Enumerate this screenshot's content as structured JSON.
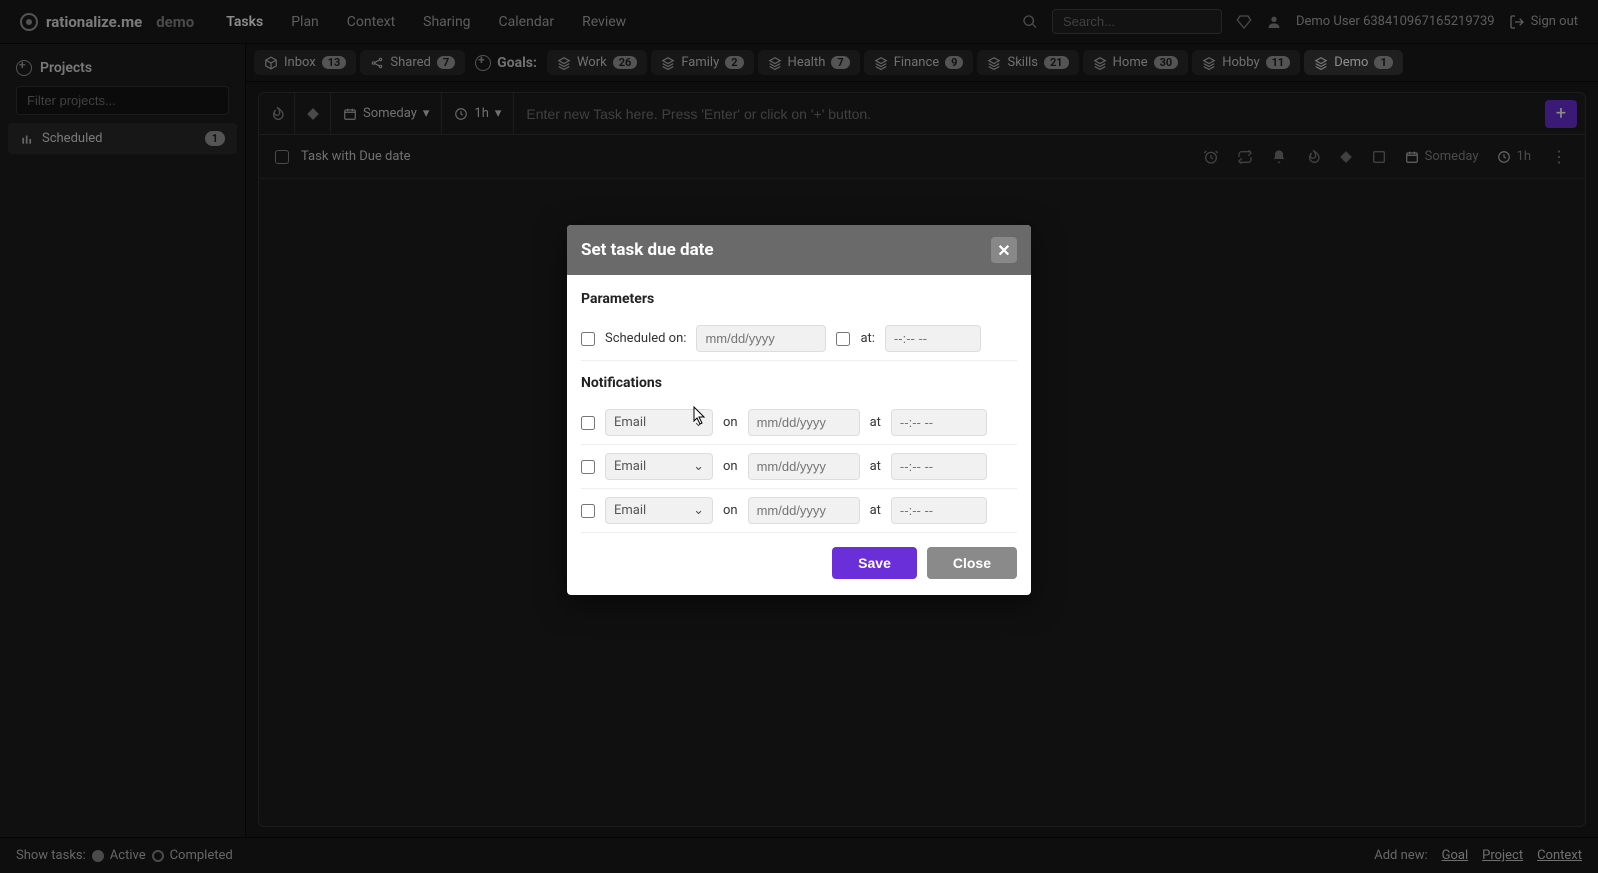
{
  "brand": {
    "name": "rationalize.me",
    "mode": "demo"
  },
  "nav": {
    "items": [
      {
        "label": "Tasks",
        "active": true
      },
      {
        "label": "Plan"
      },
      {
        "label": "Context"
      },
      {
        "label": "Sharing"
      },
      {
        "label": "Calendar"
      },
      {
        "label": "Review"
      }
    ],
    "search_placeholder": "Search...",
    "user": "Demo User 638410967165219739",
    "signout": "Sign out"
  },
  "sidebar": {
    "projects_label": "Projects",
    "filter_placeholder": "Filter projects...",
    "items": [
      {
        "label": "Scheduled",
        "count": "1"
      }
    ]
  },
  "tabs": {
    "inbox": {
      "label": "Inbox",
      "count": "13"
    },
    "shared": {
      "label": "Shared",
      "count": "7"
    },
    "goals_label": "Goals:",
    "goals": [
      {
        "label": "Work",
        "count": "26"
      },
      {
        "label": "Family",
        "count": "2"
      },
      {
        "label": "Health",
        "count": "7"
      },
      {
        "label": "Finance",
        "count": "9"
      },
      {
        "label": "Skills",
        "count": "21"
      },
      {
        "label": "Home",
        "count": "30"
      },
      {
        "label": "Hobby",
        "count": "11"
      },
      {
        "label": "Demo",
        "count": "1",
        "active": true
      }
    ]
  },
  "entry": {
    "when": "Someday",
    "duration": "1h",
    "placeholder": "Enter new Task here. Press 'Enter' or click on '+' button."
  },
  "task": {
    "title": "Task with Due date",
    "when": "Someday",
    "duration": "1h"
  },
  "footer": {
    "show_label": "Show tasks:",
    "active": "Active",
    "completed": "Completed",
    "addnew": "Add new:",
    "links": [
      "Goal",
      "Project",
      "Context"
    ]
  },
  "modal": {
    "title": "Set task due date",
    "parameters_label": "Parameters",
    "scheduled_label": "Scheduled on:",
    "date_placeholder": "mm/dd/yyyy",
    "at_label": "at:",
    "at_label2": "at",
    "time_placeholder": "--:-- --",
    "notifications_label": "Notifications",
    "on_label": "on",
    "channel": "Email",
    "save": "Save",
    "close": "Close"
  }
}
